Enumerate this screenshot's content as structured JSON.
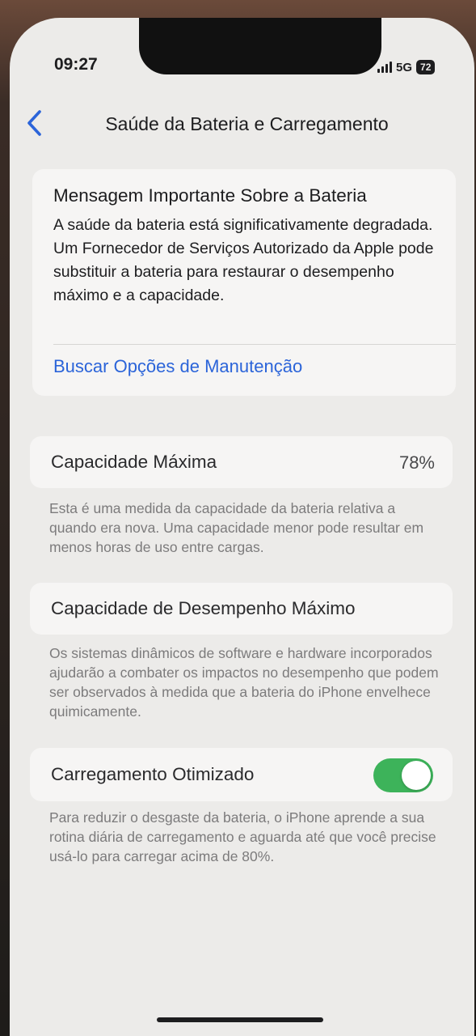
{
  "status_bar": {
    "time": "09:27",
    "network": "5G",
    "battery_level": "72"
  },
  "nav": {
    "back_icon": "chevron-left-icon",
    "title": "Saúde da Bateria e Carregamento"
  },
  "message_card": {
    "title": "Mensagem Importante Sobre a Bateria",
    "body": "A saúde da bateria está significativamente degradada. Um Fornecedor de Serviços Autorizado da Apple pode substituir a bateria para restaurar o desempenho máximo e a capacidade.",
    "link": "Buscar Opções de Manutenção"
  },
  "max_capacity": {
    "label": "Capacidade Máxima",
    "value": "78%",
    "footnote": "Esta é uma medida da capacidade da bateria relativa a quando era nova. Uma capacidade menor pode resultar em menos horas de uso entre cargas."
  },
  "peak_performance": {
    "label": "Capacidade de Desempenho Máximo",
    "footnote": "Os sistemas dinâmicos de software e hardware incorporados ajudarão a combater os impactos no desempenho que podem ser observados à medida que a bateria do iPhone envelhece quimicamente."
  },
  "optimized_charging": {
    "label": "Carregamento Otimizado",
    "enabled": true,
    "footnote": "Para reduzir o desgaste da bateria, o iPhone aprende a sua rotina diária de carregamento e aguarda até que você precise usá-lo para carregar acima de 80%."
  },
  "colors": {
    "link": "#2b64d9",
    "toggle_on": "#3db35a",
    "background": "#ecebe9",
    "card": "#f6f5f4"
  }
}
